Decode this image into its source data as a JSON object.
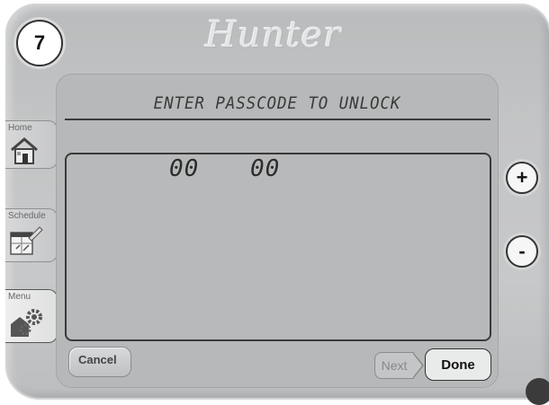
{
  "step_number": "7",
  "brand": "Hunter",
  "screen": {
    "title": "ENTER PASSCODE TO UNLOCK",
    "passcode_digits": [
      "00",
      "00"
    ]
  },
  "buttons": {
    "cancel": "Cancel",
    "next": "Next",
    "done": "Done",
    "increment": "+",
    "decrement": "-"
  },
  "side_tabs": [
    {
      "label": "Home",
      "icon": "house-icon"
    },
    {
      "label": "Schedule",
      "icon": "schedule-icon"
    },
    {
      "label": "Menu",
      "icon": "gears-icon"
    }
  ]
}
